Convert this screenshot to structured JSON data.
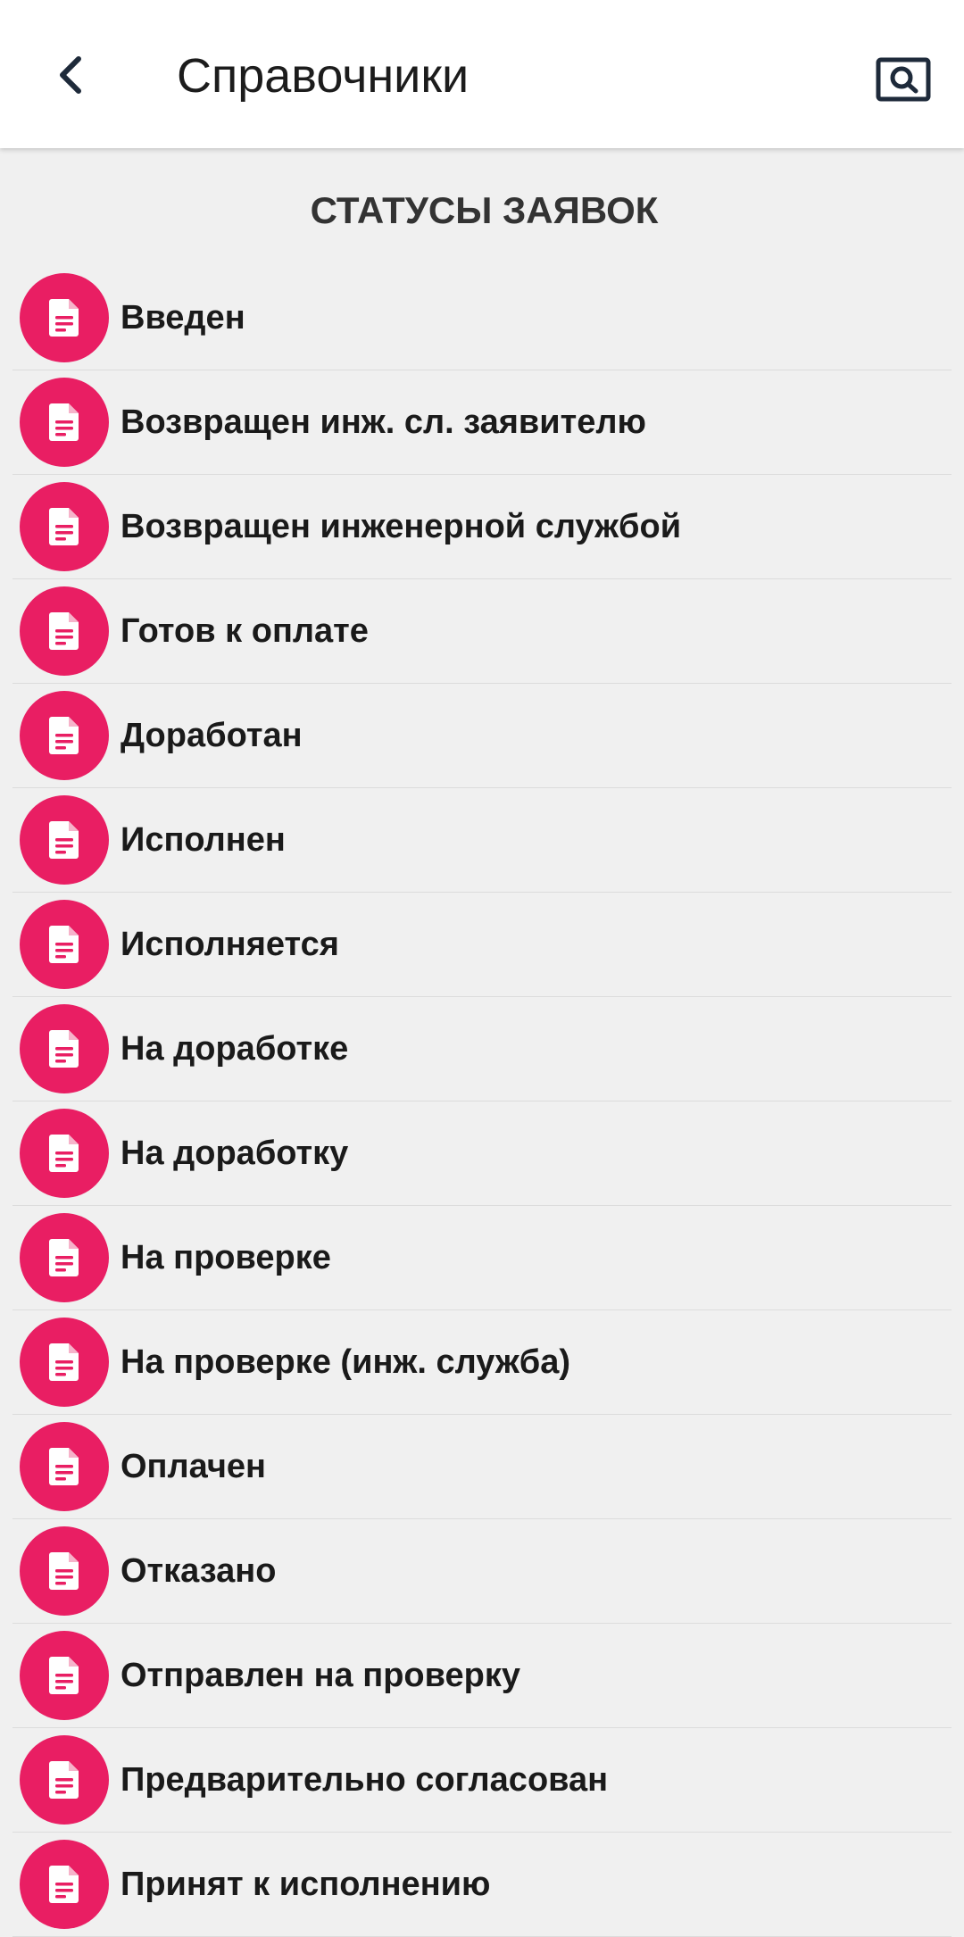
{
  "header": {
    "title": "Справочники",
    "back_icon": "chevron-left-icon",
    "search_icon": "search-icon"
  },
  "section": {
    "title": "СТАТУСЫ ЗАЯВОК"
  },
  "colors": {
    "accent": "#e91e63",
    "appbar": "#ffffff",
    "background": "#f0f0f0"
  },
  "items": [
    {
      "label": "Введен",
      "icon": "document-icon"
    },
    {
      "label": "Возвращен инж. сл. заявителю",
      "icon": "document-icon"
    },
    {
      "label": "Возвращен инженерной службой",
      "icon": "document-icon"
    },
    {
      "label": "Готов к оплате",
      "icon": "document-icon"
    },
    {
      "label": "Доработан",
      "icon": "document-icon"
    },
    {
      "label": "Исполнен",
      "icon": "document-icon"
    },
    {
      "label": "Исполняется",
      "icon": "document-icon"
    },
    {
      "label": "На доработке",
      "icon": "document-icon"
    },
    {
      "label": "На доработку",
      "icon": "document-icon"
    },
    {
      "label": "На проверке",
      "icon": "document-icon"
    },
    {
      "label": "На проверке (инж. служба)",
      "icon": "document-icon"
    },
    {
      "label": "Оплачен",
      "icon": "document-icon"
    },
    {
      "label": "Отказано",
      "icon": "document-icon"
    },
    {
      "label": "Отправлен на проверку",
      "icon": "document-icon"
    },
    {
      "label": "Предварительно согласован",
      "icon": "document-icon"
    },
    {
      "label": "Принят к исполнению",
      "icon": "document-icon"
    }
  ]
}
